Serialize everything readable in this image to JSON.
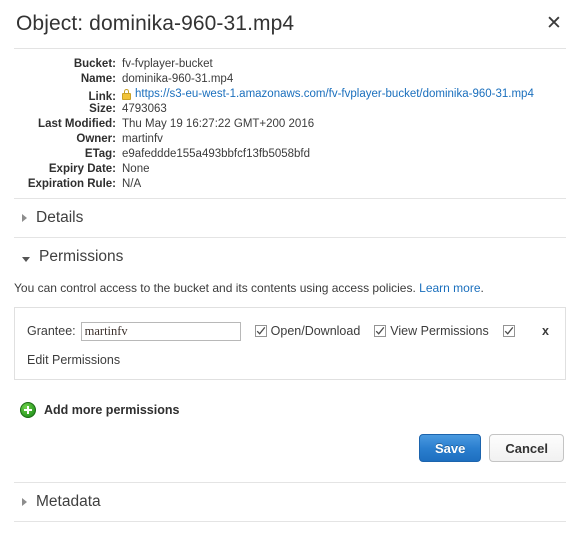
{
  "header": {
    "title": "Object: dominika-960-31.mp4",
    "close_icon": "close-icon",
    "close_label": "✕"
  },
  "metadata": {
    "rows": [
      {
        "label": "Bucket:",
        "value": "fv-fvplayer-bucket",
        "type": "text"
      },
      {
        "label": "Name:",
        "value": "dominika-960-31.mp4",
        "type": "text"
      },
      {
        "label": "Link:",
        "value": "https://s3-eu-west-1.amazonaws.com/fv-fvplayer-bucket/dominika-960-31.mp4",
        "type": "link"
      },
      {
        "label": "Size:",
        "value": "4793063",
        "type": "text"
      },
      {
        "label": "Last Modified:",
        "value": "Thu May 19 16:27:22 GMT+200 2016",
        "type": "text"
      },
      {
        "label": "Owner:",
        "value": "martinfv",
        "type": "text"
      },
      {
        "label": "ETag:",
        "value": "e9afeddde155a493bbfcf13fb5058bfd",
        "type": "text"
      },
      {
        "label": "Expiry Date:",
        "value": "None",
        "type": "text"
      },
      {
        "label": "Expiration Rule:",
        "value": "N/A",
        "type": "text"
      }
    ]
  },
  "sections": {
    "details": {
      "title": "Details",
      "expanded": false
    },
    "permissions": {
      "title": "Permissions",
      "expanded": true
    },
    "metadata": {
      "title": "Metadata",
      "expanded": false
    }
  },
  "permissions": {
    "description": "You can control access to the bucket and its contents using access policies.",
    "learn_more": "Learn more",
    "description_end": ".",
    "grantee": {
      "label": "Grantee:",
      "value": "martinfv",
      "placeholder": "Grantee"
    },
    "checkboxes": [
      {
        "label": "Open/Download",
        "checked": true
      },
      {
        "label": "View Permissions",
        "checked": true
      },
      {
        "label": "",
        "checked": true
      }
    ],
    "remove_label": "x",
    "edit_permissions": "Edit Permissions",
    "add_more": "Add more permissions"
  },
  "buttons": {
    "save": "Save",
    "cancel": "Cancel"
  },
  "colors": {
    "accent": "#1a6fbd",
    "primary_button": "#2b7fcf",
    "add_icon": "#2d9c23",
    "lock_icon": "#f2c438"
  }
}
